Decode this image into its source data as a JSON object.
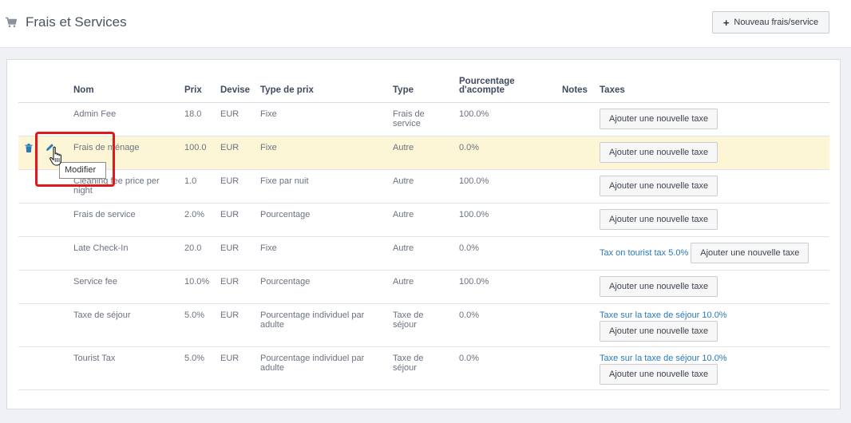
{
  "header": {
    "title": "Frais et Services",
    "new_button_label": "Nouveau frais/service"
  },
  "table": {
    "columns": {
      "nom": "Nom",
      "prix": "Prix",
      "devise": "Devise",
      "type_prix": "Type de prix",
      "type": "Type",
      "pourcentage_1": "Pourcentage",
      "pourcentage_2": "d'acompte",
      "notes": "Notes",
      "taxes": "Taxes"
    },
    "add_tax_label": "Ajouter une nouvelle taxe",
    "rows": [
      {
        "nom_1": "Admin Fee",
        "nom_2": "",
        "prix": "18.0",
        "devise": "EUR",
        "type_prix_1": "Fixe",
        "type_prix_2": "",
        "type_1": "Frais de",
        "type_2": "service",
        "acompte": "100.0%",
        "notes": "",
        "tax_link": ""
      },
      {
        "nom_1": "Frais de ménage",
        "nom_2": "",
        "prix": "100.0",
        "devise": "EUR",
        "type_prix_1": "Fixe",
        "type_prix_2": "",
        "type_1": "Autre",
        "type_2": "",
        "acompte": "0.0%",
        "notes": "",
        "tax_link": ""
      },
      {
        "nom_1": "Cleaning fee price per",
        "nom_2": "night",
        "prix": "1.0",
        "devise": "EUR",
        "type_prix_1": "Fixe par nuit",
        "type_prix_2": "",
        "type_1": "Autre",
        "type_2": "",
        "acompte": "100.0%",
        "notes": "",
        "tax_link": ""
      },
      {
        "nom_1": "Frais de service",
        "nom_2": "",
        "prix": "2.0%",
        "devise": "EUR",
        "type_prix_1": "Pourcentage",
        "type_prix_2": "",
        "type_1": "Autre",
        "type_2": "",
        "acompte": "100.0%",
        "notes": "",
        "tax_link": ""
      },
      {
        "nom_1": "Late Check-In",
        "nom_2": "",
        "prix": "20.0",
        "devise": "EUR",
        "type_prix_1": "Fixe",
        "type_prix_2": "",
        "type_1": "Autre",
        "type_2": "",
        "acompte": "0.0%",
        "notes": "",
        "tax_link": "Tax on tourist tax 5.0%"
      },
      {
        "nom_1": "Service fee",
        "nom_2": "",
        "prix": "10.0%",
        "devise": "EUR",
        "type_prix_1": "Pourcentage",
        "type_prix_2": "",
        "type_1": "Autre",
        "type_2": "",
        "acompte": "100.0%",
        "notes": "",
        "tax_link": ""
      },
      {
        "nom_1": "Taxe de séjour",
        "nom_2": "",
        "prix": "5.0%",
        "devise": "EUR",
        "type_prix_1": "Pourcentage individuel par",
        "type_prix_2": "adulte",
        "type_1": "Taxe de",
        "type_2": "séjour",
        "acompte": "0.0%",
        "notes": "",
        "tax_link": "Taxe sur la taxe de séjour 10.0%"
      },
      {
        "nom_1": "Tourist Tax",
        "nom_2": "",
        "prix": "5.0%",
        "devise": "EUR",
        "type_prix_1": "Pourcentage individuel par",
        "type_prix_2": "adulte",
        "type_1": "Taxe de",
        "type_2": "séjour",
        "acompte": "0.0%",
        "notes": "",
        "tax_link": "Taxe sur la taxe de séjour 10.0%"
      }
    ]
  },
  "tooltip": {
    "label": "Modifier"
  },
  "colors": {
    "accent_link": "#2a7ab8",
    "highlight_row": "#fdf6d6",
    "annotation_red": "#e0191c"
  }
}
